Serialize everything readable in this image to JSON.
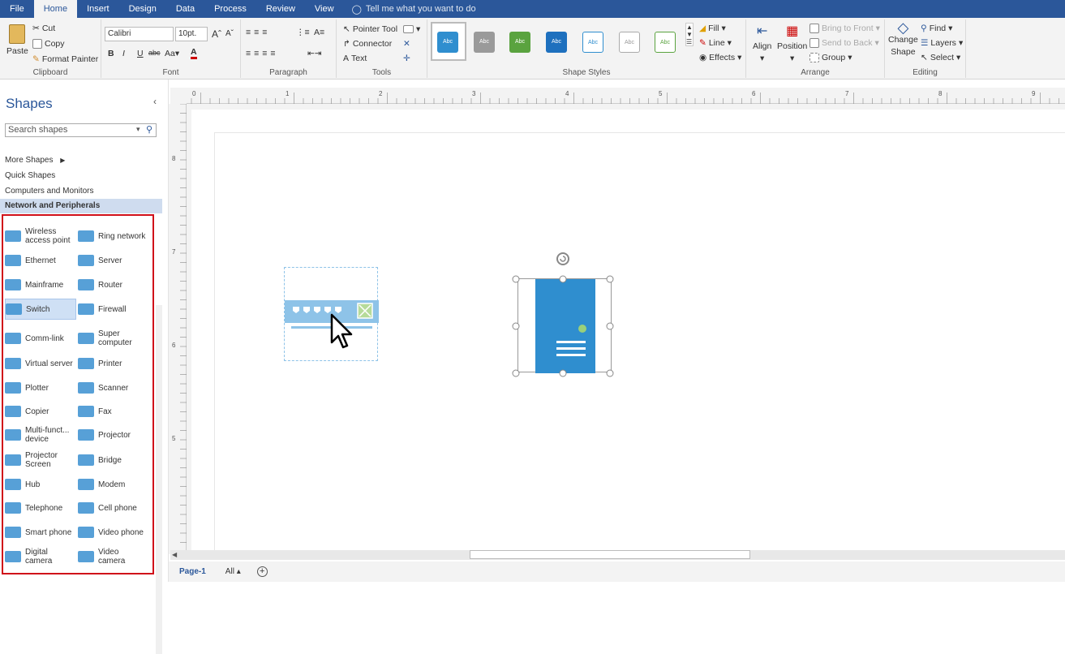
{
  "tabs": [
    "File",
    "Home",
    "Insert",
    "Design",
    "Data",
    "Process",
    "Review",
    "View"
  ],
  "tell_me": "Tell me what you want to do",
  "clipboard": {
    "paste": "Paste",
    "cut": "Cut",
    "copy": "Copy",
    "format_painter": "Format Painter",
    "group": "Clipboard"
  },
  "font": {
    "name": "Calibri",
    "size": "10pt.",
    "group": "Font"
  },
  "paragraph": {
    "group": "Paragraph"
  },
  "tools": {
    "pointer": "Pointer Tool",
    "connector": "Connector",
    "text": "Text",
    "group": "Tools"
  },
  "shape_styles": {
    "swatch": "Abc",
    "group": "Shape Styles",
    "fill": "Fill",
    "line": "Line",
    "effects": "Effects"
  },
  "arrange": {
    "align": "Align",
    "position": "Position",
    "bring_front": "Bring to Front",
    "send_back": "Send to Back",
    "group_btn": "Group",
    "group": "Arrange"
  },
  "editing": {
    "change_shape": "Change",
    "change_shape2": "Shape",
    "find": "Find",
    "layers": "Layers",
    "select": "Select",
    "group": "Editing"
  },
  "sidebar": {
    "title": "Shapes",
    "search_placeholder": "Search shapes",
    "more_shapes": "More Shapes",
    "quick_shapes": "Quick Shapes",
    "computers": "Computers and Monitors",
    "network": "Network and Peripherals"
  },
  "stencil": [
    [
      "Wireless access point",
      "Ring network"
    ],
    [
      "Ethernet",
      "Server"
    ],
    [
      "Mainframe",
      "Router"
    ],
    [
      "Switch",
      "Firewall"
    ],
    [
      "Comm-link",
      "Super computer"
    ],
    [
      "Virtual server",
      "Printer"
    ],
    [
      "Plotter",
      "Scanner"
    ],
    [
      "Copier",
      "Fax"
    ],
    [
      "Multi-funct... device",
      "Projector"
    ],
    [
      "Projector Screen",
      "Bridge"
    ],
    [
      "Hub",
      "Modem"
    ],
    [
      "Telephone",
      "Cell phone"
    ],
    [
      "Smart phone",
      "Video phone"
    ],
    [
      "Digital camera",
      "Video camera"
    ]
  ],
  "ruler_top": [
    "0",
    "1",
    "2",
    "3",
    "4",
    "5",
    "6",
    "7",
    "8",
    "9"
  ],
  "ruler_left": [
    "8",
    "7",
    "6",
    "5"
  ],
  "bottom": {
    "page": "Page-1",
    "all": "All"
  },
  "colors": {
    "accent": "#2b579a",
    "shape_blue": "#2f8ecf",
    "light_blue": "#8ec3e8",
    "selection_red": "#d0101a"
  }
}
